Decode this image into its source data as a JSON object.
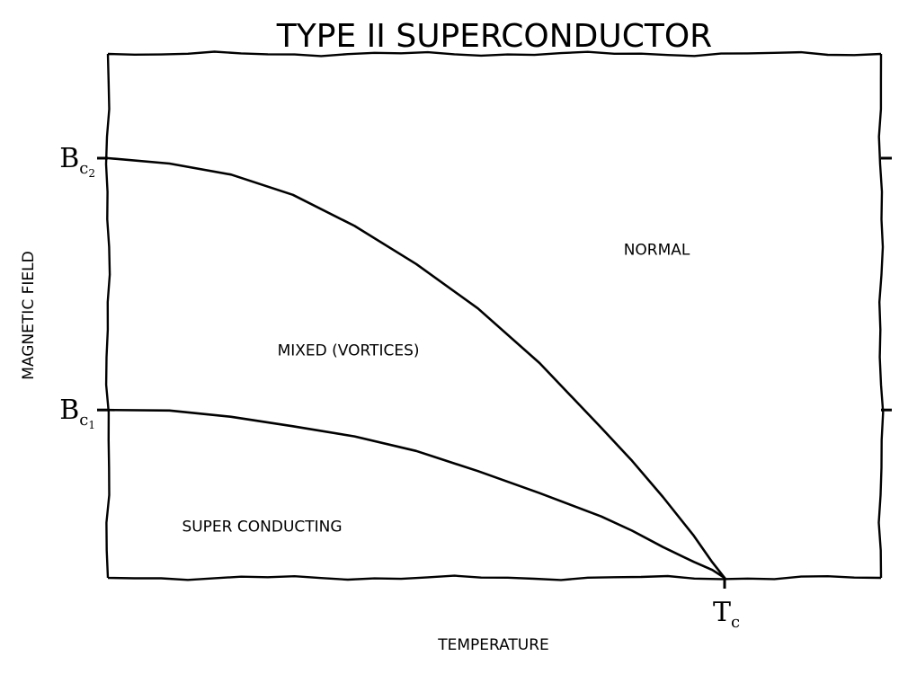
{
  "chart_data": {
    "type": "line",
    "title": "TYPE II SUPERCONDUCTOR",
    "xlabel": "TEMPERATURE",
    "ylabel": "MAGNETIC FIELD",
    "xlim": [
      0,
      1.25
    ],
    "ylim": [
      0,
      1.1
    ],
    "x_ticks": [
      {
        "value": 1.0,
        "label": "T",
        "sub": "c"
      }
    ],
    "y_ticks": [
      {
        "value": 1.0,
        "label": "B",
        "sub": "c2"
      },
      {
        "value": 0.4,
        "label": "B",
        "sub": "c1"
      }
    ],
    "series": [
      {
        "x": [
          0,
          0.1,
          0.2,
          0.3,
          0.4,
          0.5,
          0.6,
          0.7,
          0.8,
          0.85,
          0.9,
          0.95,
          0.98,
          1.0
        ],
        "y": [
          1.0,
          0.99,
          0.96,
          0.91,
          0.84,
          0.75,
          0.64,
          0.51,
          0.36,
          0.28,
          0.19,
          0.1,
          0.04,
          0.0
        ]
      },
      {
        "x": [
          0,
          0.1,
          0.2,
          0.3,
          0.4,
          0.5,
          0.6,
          0.7,
          0.8,
          0.85,
          0.9,
          0.95,
          0.98,
          1.0
        ],
        "y": [
          0.4,
          0.396,
          0.384,
          0.364,
          0.336,
          0.3,
          0.256,
          0.204,
          0.144,
          0.111,
          0.076,
          0.039,
          0.016,
          0.0
        ]
      }
    ],
    "annotations": [
      {
        "text": "NORMAL",
        "x": 0.89,
        "y": 0.77
      },
      {
        "text": "MIXED (VORTICES)",
        "x": 0.39,
        "y": 0.53
      },
      {
        "text": "SUPER CONDUCTING",
        "x": 0.25,
        "y": 0.11
      }
    ],
    "grid": false,
    "legend": "none"
  }
}
